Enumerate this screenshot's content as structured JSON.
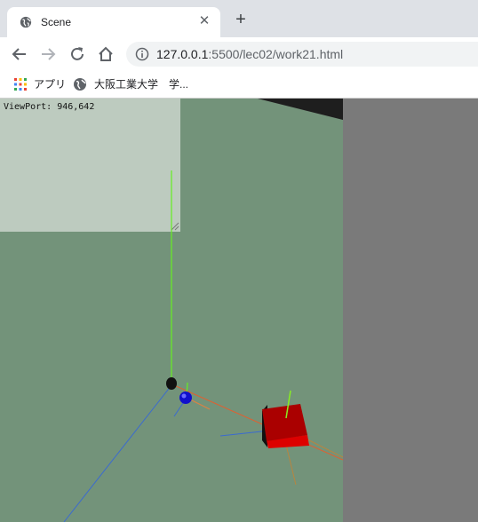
{
  "browser": {
    "tab": {
      "title": "Scene"
    },
    "url": {
      "host": "127.0.0.1",
      "path": ":5500/lec02/work21.html"
    },
    "bookmarks": [
      {
        "label": "アプリ",
        "icon": "apps-grid-icon"
      },
      {
        "label": "大阪工業大学",
        "icon": "globe-icon"
      },
      {
        "label": "学..."
      }
    ]
  },
  "scene": {
    "viewport_label": "ViewPort: 946,642",
    "colors": {
      "background": "#7a7a7a",
      "ground": "#73937a",
      "minimap": "#bdcbbf",
      "box": "#cc0000",
      "sphere": "#1010cc",
      "axis_y": "#66ee22",
      "axis_x": "#e06030",
      "axis_z": "#3a6ad0"
    }
  }
}
